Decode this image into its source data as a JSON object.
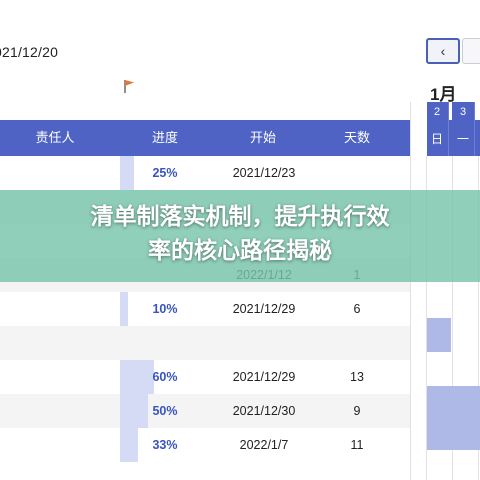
{
  "top_date": "021/12/20",
  "nav": {
    "prev_label": "‹"
  },
  "calendar": {
    "month": "1月",
    "days": [
      {
        "num": "2",
        "day": "日"
      },
      {
        "num": "3",
        "day": "一"
      }
    ]
  },
  "table": {
    "headers": [
      "责任人",
      "进度",
      "开始",
      "天数"
    ],
    "rows": [
      {
        "progress": "25%",
        "start": "2021/12/23",
        "days": "",
        "progress_value": 25
      },
      {
        "progress": "",
        "start": "",
        "days": "",
        "progress_value": 0
      },
      {
        "progress": "",
        "start": "",
        "days": "",
        "progress_value": 0
      },
      {
        "progress": "",
        "start": "2022/1/12",
        "days": "1",
        "progress_value": 0
      },
      {
        "progress": "10%",
        "start": "2021/12/29",
        "days": "6",
        "progress_value": 10
      },
      {
        "progress": "",
        "start": "",
        "days": "",
        "progress_value": 0
      },
      {
        "progress": "60%",
        "start": "2021/12/29",
        "days": "13",
        "progress_value": 60
      },
      {
        "progress": "50%",
        "start": "2021/12/30",
        "days": "9",
        "progress_value": 50
      },
      {
        "progress": "33%",
        "start": "2022/1/7",
        "days": "11",
        "progress_value": 33
      }
    ]
  },
  "overlay": {
    "line1": "清单制落实机制，提升执行效",
    "line2": "率的核心路径揭秘"
  },
  "colors": {
    "header_bg": "#4e63c4",
    "progress_text": "#3954c2",
    "progress_bar": "#d5dbf4",
    "calendar_fill": "#aeb9e8",
    "overlay_bg": "#78c4aa"
  }
}
